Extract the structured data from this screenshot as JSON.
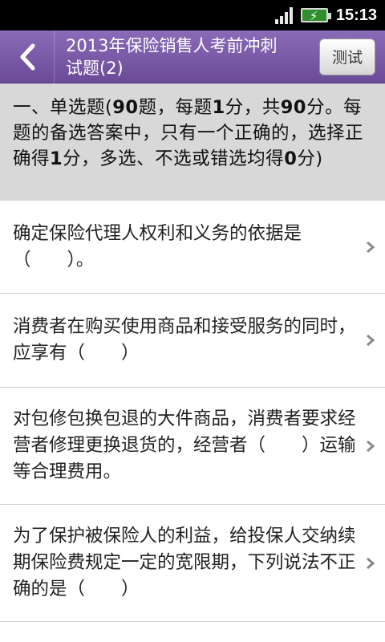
{
  "status": {
    "time": "15:13"
  },
  "header": {
    "title": "2013年保险销售人考前冲刺\n试题(2)",
    "test_label": "测试"
  },
  "section": {
    "p1": "一、单选题(",
    "n1": "90",
    "p2": "题，每题",
    "n2": "1",
    "p3": "分，共",
    "n3": "90",
    "p4": "分。每题的备选答案中，只有一个正确的，选择正确得",
    "n4": "1",
    "p5": "分，多选、不选或错选均得",
    "n5": "0",
    "p6": "分)"
  },
  "questions": [
    {
      "text": "确定保险代理人权利和义务的依据是（　　）。"
    },
    {
      "text": "消费者在购买使用商品和接受服务的同时，应享有（　　）"
    },
    {
      "text": "对包修包换包退的大件商品，消费者要求经营者修理更换退货的，经营者（　　）运输等合理费用。"
    },
    {
      "text": "为了保护被保险人的利益，给投保人交纳续期保险费规定一定的宽限期，下列说法不正确的是（　　）"
    }
  ]
}
